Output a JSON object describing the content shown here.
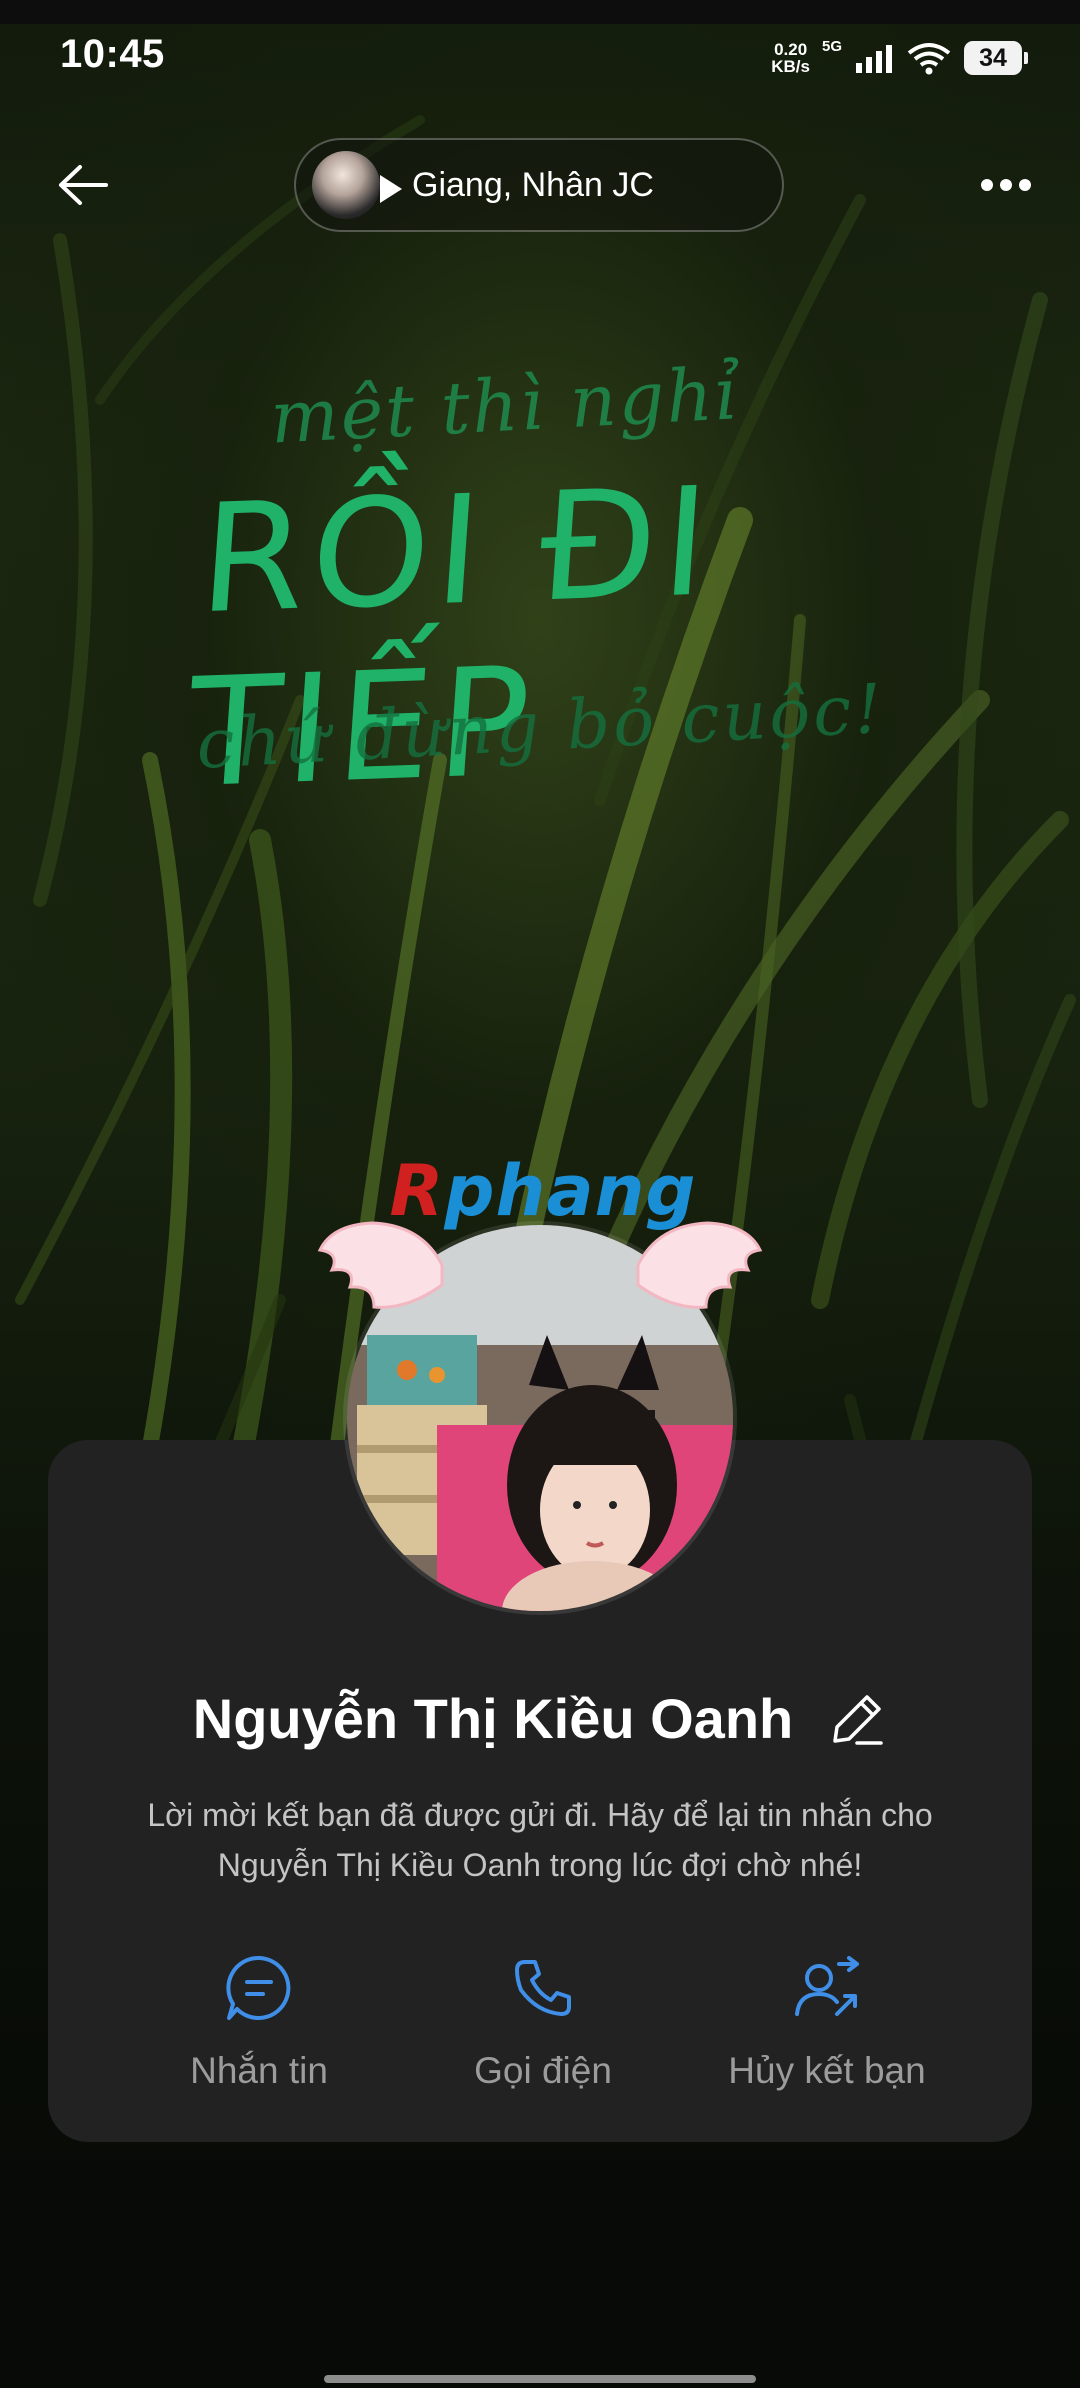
{
  "status_bar": {
    "time": "10:45",
    "net_speed_value": "0.20",
    "net_speed_unit": "KB/s",
    "network_type": "5G",
    "battery": "34"
  },
  "header": {
    "music_title": "Giang, Nhân JC"
  },
  "cover": {
    "quote_line1": "mệt thì nghỉ",
    "quote_line2": "RỒI ĐI TIẾP",
    "quote_line3": "chứ đừng bỏ cuộc!",
    "frame_text_first": "R",
    "frame_text_rest": "phang"
  },
  "profile": {
    "name": "Nguyễn Thị Kiều Oanh",
    "pending_message": "Lời mời kết bạn đã được gửi đi. Hãy để lại tin nhắn cho Nguyễn Thị Kiều Oanh trong lúc đợi chờ nhé!"
  },
  "actions": [
    {
      "label": "Nhắn tin",
      "icon": "chat-bubble-icon"
    },
    {
      "label": "Gọi điện",
      "icon": "phone-icon"
    },
    {
      "label": "Hủy kết bạn",
      "icon": "unfriend-icon"
    }
  ],
  "colors": {
    "accent": "#3f8ee8",
    "card_background": "#222222",
    "quote_green": "#1fb268"
  }
}
